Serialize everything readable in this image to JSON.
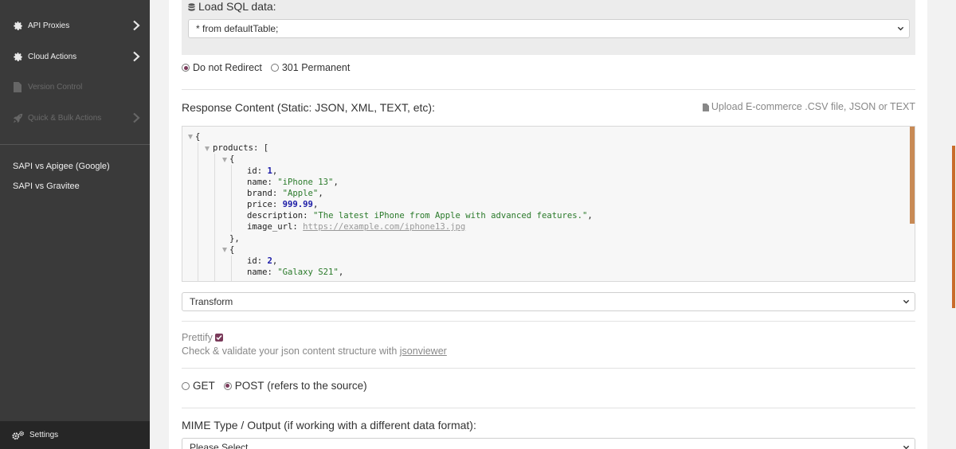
{
  "sidebar": {
    "items": [
      {
        "label": "API Proxies",
        "icon": "gear-icon",
        "enabled": true
      },
      {
        "label": "Cloud Actions",
        "icon": "gear-icon",
        "enabled": true
      },
      {
        "label": "Version Control",
        "icon": "file-icon",
        "enabled": false
      },
      {
        "label": "Quick & Bulk Actions",
        "icon": "rocket-icon",
        "enabled": false
      }
    ],
    "links": [
      "SAPI vs Apigee (Google)",
      "SAPI vs Gravitee"
    ],
    "settings_label": "Settings"
  },
  "sql": {
    "title": "Load SQL data:",
    "query": "* from defaultTable;"
  },
  "redirect": {
    "options": [
      "Do not Redirect",
      "301 Permanent"
    ],
    "selected": "Do not Redirect"
  },
  "response": {
    "label": "Response Content (Static: JSON, XML, TEXT, etc):",
    "upload_label": "Upload E-commerce .CSV file, JSON or TEXT",
    "editor_lines": {
      "l1": "{",
      "l2_key": "products",
      "l2_rest": ": [",
      "l3": "{",
      "l4_key": "id",
      "l4_val": "1",
      "l5_key": "name",
      "l5_val": "\"iPhone 13\"",
      "l6_key": "brand",
      "l6_val": "\"Apple\"",
      "l7_key": "price",
      "l7_val": "999.99",
      "l8_key": "description",
      "l8_val": "\"The latest iPhone from Apple with advanced features.\"",
      "l9_key": "image_url",
      "l9_val": "https://example.com/iphone13.jpg",
      "l10": "},",
      "l11": "{",
      "l12_key": "id",
      "l12_val": "2",
      "l13_key": "name",
      "l13_val": "\"Galaxy S21\""
    }
  },
  "transform": {
    "selected": "Transform"
  },
  "prettify": {
    "label": "Prettify",
    "checked": true,
    "validate_text": "Check & validate your json content structure with",
    "validate_link": "jsonviewer"
  },
  "method": {
    "options": [
      "GET",
      "POST"
    ],
    "selected": "POST",
    "note": "(refers to the source)"
  },
  "mime": {
    "label": "MIME Type / Output (if working with a different data format):",
    "placeholder": "Please Select"
  },
  "colors": {
    "sidebar_bg": "#3a3a3a",
    "accent": "#7a3a5a",
    "scroll": "#c88a55"
  }
}
